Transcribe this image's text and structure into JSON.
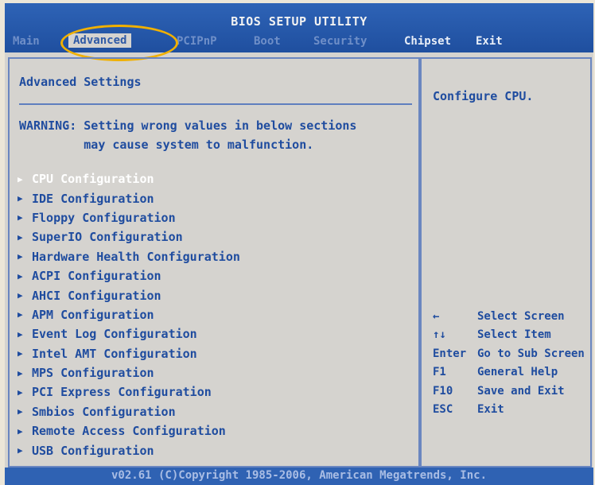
{
  "window": {
    "title": "BIOS SETUP UTILITY"
  },
  "tabs": [
    {
      "label": "Main"
    },
    {
      "label": "Advanced"
    },
    {
      "label": "PCIPnP"
    },
    {
      "label": "Boot"
    },
    {
      "label": "Security"
    },
    {
      "label": "Chipset"
    },
    {
      "label": "Exit"
    }
  ],
  "main": {
    "heading": "Advanced Settings",
    "warning": "WARNING: Setting wrong values in below sections\n         may cause system to malfunction.",
    "items": [
      {
        "label": "CPU Configuration"
      },
      {
        "label": "IDE Configuration"
      },
      {
        "label": "Floppy Configuration"
      },
      {
        "label": "SuperIO Configuration"
      },
      {
        "label": "Hardware Health Configuration"
      },
      {
        "label": "ACPI Configuration"
      },
      {
        "label": "AHCI Configuration"
      },
      {
        "label": "APM Configuration"
      },
      {
        "label": "Event Log Configuration"
      },
      {
        "label": "Intel AMT Configuration"
      },
      {
        "label": "MPS Configuration"
      },
      {
        "label": "PCI Express Configuration"
      },
      {
        "label": "Smbios Configuration"
      },
      {
        "label": "Remote Access Configuration"
      },
      {
        "label": "USB Configuration"
      }
    ]
  },
  "help": {
    "text": "Configure CPU.",
    "keys": [
      {
        "key": "←",
        "desc": "Select Screen"
      },
      {
        "key": "↑↓",
        "desc": "Select Item"
      },
      {
        "key": "Enter",
        "desc": "Go to Sub Screen"
      },
      {
        "key": "F1",
        "desc": "General Help"
      },
      {
        "key": "F10",
        "desc": "Save and Exit"
      },
      {
        "key": "ESC",
        "desc": "Exit"
      }
    ]
  },
  "footer": {
    "copyright": "v02.61 (C)Copyright 1985-2006, American Megatrends, Inc."
  },
  "colors": {
    "accent": "#1f4c9f",
    "bar": "#2f62b3",
    "panel": "#d5d3cf",
    "highlight_ring": "#f0b000"
  },
  "icons": {
    "menu_arrow": "triangle-right-icon"
  }
}
